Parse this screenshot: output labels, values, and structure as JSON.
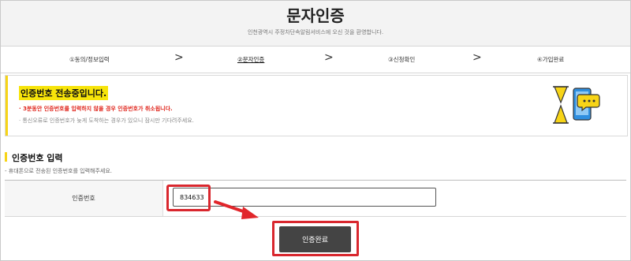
{
  "header": {
    "title": "문자인증",
    "subtitle": "인천광역시 주정차단속알림서비스에 오신 것을 환영합니다."
  },
  "steps": [
    {
      "label": "①동의/정보입력",
      "active": false
    },
    {
      "label": "②문자인증",
      "active": true
    },
    {
      "label": "③신청확인",
      "active": false
    },
    {
      "label": "④가입완료",
      "active": false
    }
  ],
  "step_separator": ">",
  "notice": {
    "title": "인증번호 전송중입니다.",
    "warning": "· 3분동안 인증번호를 입력하지 않을 경우 인증번호가 취소됩니다.",
    "info": "· 통신오류로 인증번호가 늦게 도착하는 경우가 있으니 잠시만 기다려주세요."
  },
  "section": {
    "title": "인증번호 입력",
    "description": "- 휴대폰으로 전송된 인증번호를 입력해주세요."
  },
  "form": {
    "label": "인증번호",
    "value": "834633"
  },
  "submit_label": "인증완료",
  "colors": {
    "accent_yellow": "#f7d417",
    "warning_red": "#e0261d",
    "highlight_red": "#d9272e",
    "button_dark": "#444444"
  },
  "icons": [
    "chevron-right-icon",
    "phone-message-illustration",
    "red-arrow-annotation"
  ]
}
